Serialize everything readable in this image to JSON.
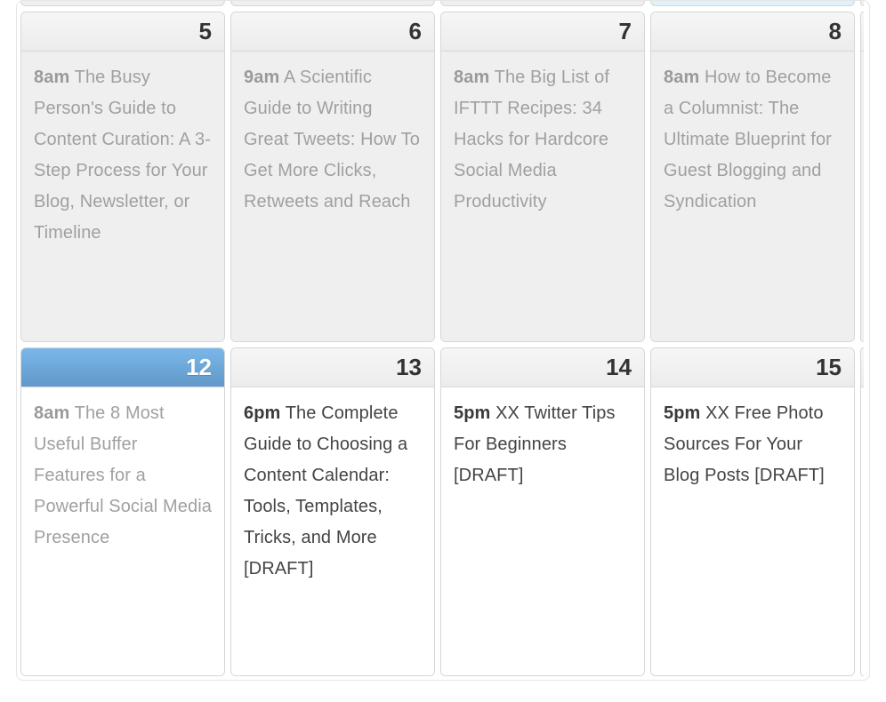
{
  "calendar": {
    "rows": [
      {
        "past": true,
        "cells": [
          {
            "day": "5",
            "time": "8am",
            "title": "The Busy Person's Guide to Content Curation: A 3-Step Process for Your Blog, Newsletter, or Timeline"
          },
          {
            "day": "6",
            "time": "9am",
            "title": "A Scientific Guide to Writing Great Tweets: How To Get More Clicks, Retweets and Reach"
          },
          {
            "day": "7",
            "time": "8am",
            "title": "The Big List of IFTTT Recipes: 34 Hacks for Hardcore Social Media Productivity"
          },
          {
            "day": "8",
            "time": "8am",
            "title": "How to Become a Columnist: The Ultimate Blueprint for Guest Blogging and Syndication"
          }
        ]
      },
      {
        "past": false,
        "cells": [
          {
            "day": "12",
            "today": true,
            "past_event": true,
            "time": "8am",
            "title": "The 8 Most Useful Buffer Features for a Powerful Social Media Presence"
          },
          {
            "day": "13",
            "time": "6pm",
            "title": "The Complete Guide to Choosing a Content Calendar: Tools, Templates, Tricks, and More [DRAFT]"
          },
          {
            "day": "14",
            "time": "5pm",
            "title": "XX Twitter Tips For Beginners [DRAFT]"
          },
          {
            "day": "15",
            "time": "5pm",
            "title": "XX Free Photo Sources For Your Blog Posts [DRAFT]"
          }
        ]
      }
    ]
  }
}
